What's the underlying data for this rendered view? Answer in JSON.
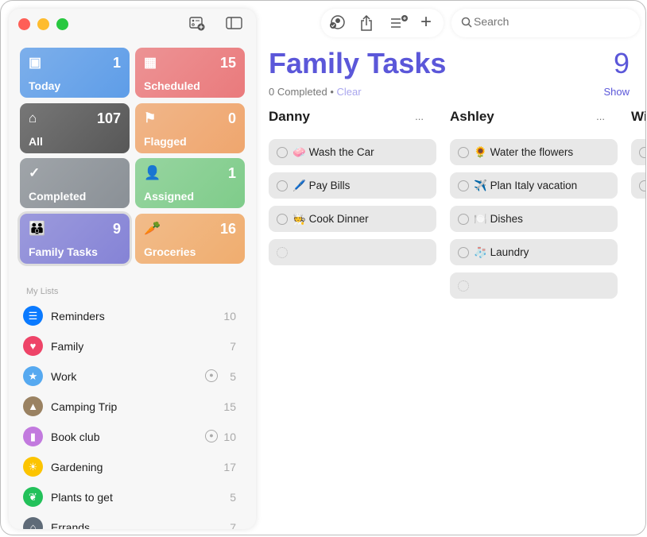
{
  "window": {
    "controls": [
      "close",
      "minimize",
      "zoom"
    ]
  },
  "sidebar": {
    "toolbar": [
      {
        "icon": "new-list-icon"
      },
      {
        "icon": "sidebar-toggle-icon"
      }
    ],
    "smart_lists": [
      {
        "label": "Today",
        "count": "1",
        "icon": "calendar-today-icon",
        "glyph": "▣",
        "color": "#5e9de8"
      },
      {
        "label": "Scheduled",
        "count": "15",
        "icon": "calendar-icon",
        "glyph": "▦",
        "color": "#ea7a7c"
      },
      {
        "label": "All",
        "count": "107",
        "icon": "tray-icon",
        "glyph": "⌂",
        "color": "#575757"
      },
      {
        "label": "Flagged",
        "count": "0",
        "icon": "flag-icon",
        "glyph": "⚑",
        "color": "#efa66e"
      },
      {
        "label": "Completed",
        "count": "",
        "icon": "checkmark-icon",
        "glyph": "✓",
        "color": "#8a9096"
      },
      {
        "label": "Assigned",
        "count": "1",
        "icon": "person-icon",
        "glyph": "👤",
        "color": "#7fcc8a"
      },
      {
        "label": "Family Tasks",
        "count": "9",
        "icon": "family-icon",
        "glyph": "👪",
        "color": "#8583d6"
      },
      {
        "label": "Groceries",
        "count": "16",
        "icon": "carrot-icon",
        "glyph": "🥕",
        "color": "#f0ad6f"
      }
    ],
    "section_title": "My Lists",
    "lists": [
      {
        "name": "Reminders",
        "count": "10",
        "icon": "list-icon",
        "glyph": "☰",
        "color": "#0a7aff",
        "shared": false
      },
      {
        "name": "Family",
        "count": "7",
        "icon": "heart-icon",
        "glyph": "♥",
        "color": "#ee4468",
        "shared": false
      },
      {
        "name": "Work",
        "count": "5",
        "icon": "star-icon",
        "glyph": "★",
        "color": "#56a9f0",
        "shared": true
      },
      {
        "name": "Camping Trip",
        "count": "15",
        "icon": "tent-icon",
        "glyph": "▲",
        "color": "#9a8262",
        "shared": false
      },
      {
        "name": "Book club",
        "count": "10",
        "icon": "bookmark-icon",
        "glyph": "▮",
        "color": "#c27ade",
        "shared": true
      },
      {
        "name": "Gardening",
        "count": "17",
        "icon": "sun-icon",
        "glyph": "☀",
        "color": "#fcc400",
        "shared": false
      },
      {
        "name": "Plants to get",
        "count": "5",
        "icon": "leaf-icon",
        "glyph": "❦",
        "color": "#23c15a",
        "shared": false
      },
      {
        "name": "Errands",
        "count": "7",
        "icon": "house-icon",
        "glyph": "⌂",
        "color": "#5f6b78",
        "shared": false
      }
    ]
  },
  "toolbar": {
    "search_placeholder": "Search"
  },
  "main": {
    "title": "Family Tasks",
    "count": "9",
    "completed": "0 Completed",
    "bullet": "•",
    "clear": "Clear",
    "show": "Show",
    "columns": [
      {
        "name": "Danny",
        "more": "...",
        "tasks": [
          {
            "emoji": "🧼",
            "text": "Wash the Car"
          },
          {
            "emoji": "🖊️",
            "text": "Pay Bills"
          },
          {
            "emoji": "🧑‍🍳",
            "text": "Cook Dinner"
          }
        ]
      },
      {
        "name": "Ashley",
        "more": "...",
        "tasks": [
          {
            "emoji": "🌻",
            "text": "Water the flowers"
          },
          {
            "emoji": "✈️",
            "text": "Plan Italy vacation"
          },
          {
            "emoji": "🍽️",
            "text": "Dishes"
          },
          {
            "emoji": "🧦",
            "text": "Laundry"
          }
        ]
      },
      {
        "name": "Wil",
        "more": "",
        "tasks": [
          {
            "emoji": "",
            "text": ""
          },
          {
            "emoji": "",
            "text": ""
          }
        ]
      }
    ]
  }
}
